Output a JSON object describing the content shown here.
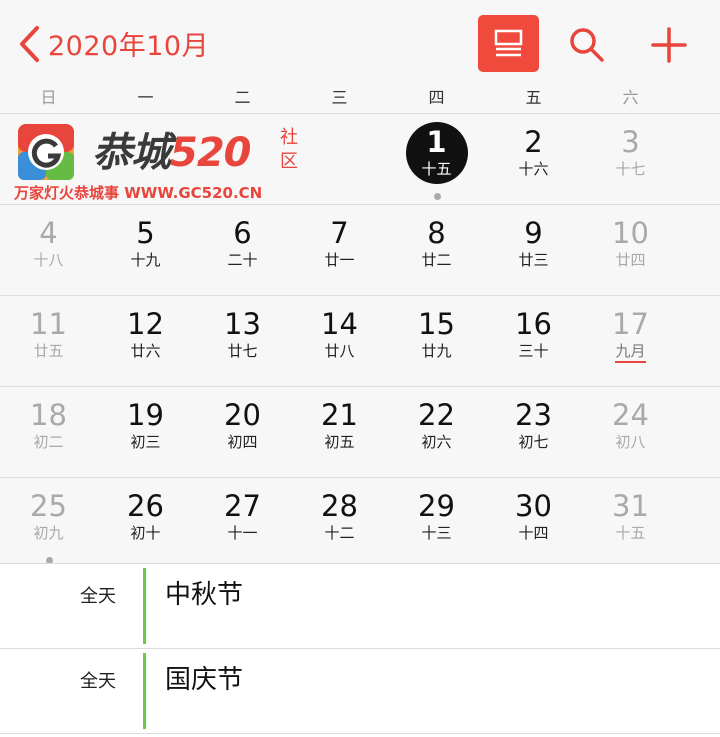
{
  "header": {
    "back_label": "2020年10月",
    "accent_color": "#e8453c",
    "icons": [
      "chevron-left-icon",
      "list-view-icon",
      "search-icon",
      "plus-icon"
    ]
  },
  "weekdays": [
    "日",
    "一",
    "二",
    "三",
    "四",
    "五",
    "六"
  ],
  "weeks": [
    [
      {
        "num": "",
        "lunar": ""
      },
      {
        "num": "",
        "lunar": ""
      },
      {
        "num": "",
        "lunar": ""
      },
      {
        "num": "",
        "lunar": ""
      },
      {
        "num": "1",
        "lunar": "十五"
      },
      {
        "num": "2",
        "lunar": "十六"
      },
      {
        "num": "3",
        "lunar": "十七"
      }
    ],
    [
      {
        "num": "4",
        "lunar": "十八"
      },
      {
        "num": "5",
        "lunar": "十九"
      },
      {
        "num": "6",
        "lunar": "二十"
      },
      {
        "num": "7",
        "lunar": "廿一"
      },
      {
        "num": "8",
        "lunar": "廿二"
      },
      {
        "num": "9",
        "lunar": "廿三"
      },
      {
        "num": "10",
        "lunar": "廿四"
      }
    ],
    [
      {
        "num": "11",
        "lunar": "廿五"
      },
      {
        "num": "12",
        "lunar": "廿六"
      },
      {
        "num": "13",
        "lunar": "廿七"
      },
      {
        "num": "14",
        "lunar": "廿八"
      },
      {
        "num": "15",
        "lunar": "廿九"
      },
      {
        "num": "16",
        "lunar": "三十"
      },
      {
        "num": "17",
        "lunar": "九月"
      }
    ],
    [
      {
        "num": "18",
        "lunar": "初二"
      },
      {
        "num": "19",
        "lunar": "初三"
      },
      {
        "num": "20",
        "lunar": "初四"
      },
      {
        "num": "21",
        "lunar": "初五"
      },
      {
        "num": "22",
        "lunar": "初六"
      },
      {
        "num": "23",
        "lunar": "初七"
      },
      {
        "num": "24",
        "lunar": "初八"
      }
    ],
    [
      {
        "num": "25",
        "lunar": "初九"
      },
      {
        "num": "26",
        "lunar": "初十"
      },
      {
        "num": "27",
        "lunar": "十一"
      },
      {
        "num": "28",
        "lunar": "十二"
      },
      {
        "num": "29",
        "lunar": "十三"
      },
      {
        "num": "30",
        "lunar": "十四"
      },
      {
        "num": "31",
        "lunar": "十五"
      }
    ]
  ],
  "events": [
    {
      "allday": "全天",
      "title": "中秋节",
      "color": "#66cc44"
    },
    {
      "allday": "全天",
      "title": "国庆节",
      "color": "#66cc44"
    }
  ],
  "watermark": {
    "name_dark": "恭城",
    "name_red": "520",
    "she": "社区",
    "url": "万家灯火恭城事 WWW.GC520.CN"
  }
}
